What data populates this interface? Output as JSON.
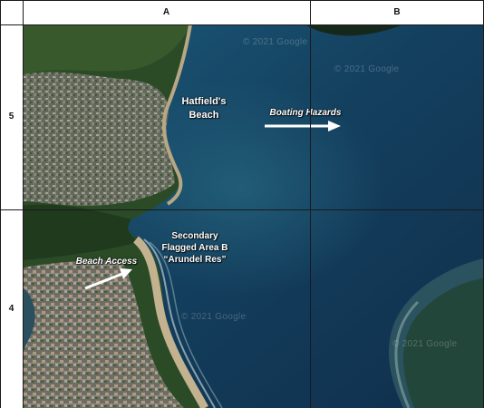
{
  "grid": {
    "columns": [
      {
        "id": "A",
        "label": "A"
      },
      {
        "id": "B",
        "label": "B"
      }
    ],
    "rows": [
      {
        "id": "5",
        "label": "5"
      },
      {
        "id": "4",
        "label": "4"
      }
    ]
  },
  "map": {
    "labels": {
      "hatfields_line1": "Hatfield's",
      "hatfields_line2": "Beach",
      "boating_hazards": "Boating Hazards",
      "secondary_line1": "Secondary",
      "secondary_line2": "Flagged Area B",
      "secondary_line3": "“Arundel Res”",
      "beach_access": "Beach Access"
    },
    "watermarks": [
      "© 2021 Google",
      "© 2021 Google",
      "© 2021 Google",
      "© 2021 Google"
    ]
  },
  "colors": {
    "sea": "#13405e",
    "land_green": "#2c4a26",
    "urban": "#7c7a70",
    "sand": "#b7a784",
    "arrow": "#ffffff"
  },
  "icons": {
    "arrow": "right-arrow-icon"
  }
}
